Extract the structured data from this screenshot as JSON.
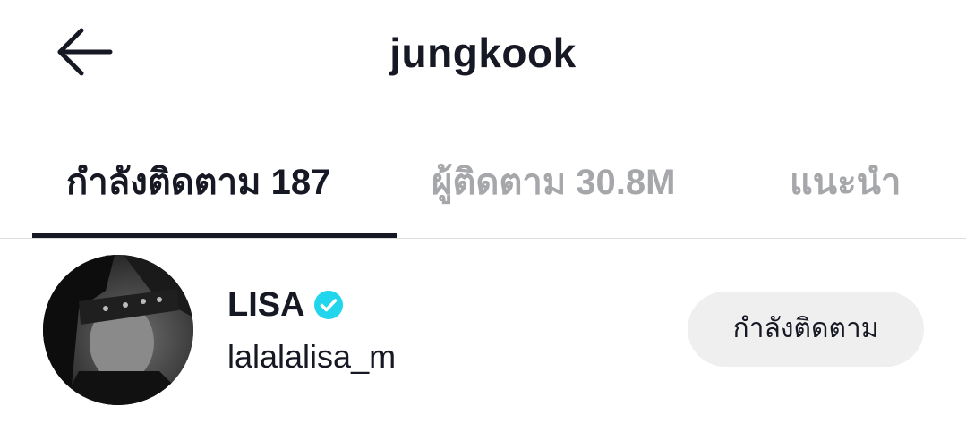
{
  "header": {
    "title": "jungkook",
    "back_icon": "arrow-left-icon"
  },
  "tabs": [
    {
      "label": "กำลังติดตาม 187",
      "active": true
    },
    {
      "label": "ผู้ติดตาม 30.8M",
      "active": false
    },
    {
      "label": "แนะนำ",
      "active": false
    }
  ],
  "users": [
    {
      "display_name": "LISA",
      "handle": "lalalalisa_m",
      "verified": true,
      "follow_button": "กำลังติดตาม"
    }
  ],
  "colors": {
    "text_primary": "#161823",
    "text_inactive": "#a6a7ab",
    "verified_badge": "#20d5ec",
    "button_bg": "#efefef",
    "divider": "#dedede"
  }
}
